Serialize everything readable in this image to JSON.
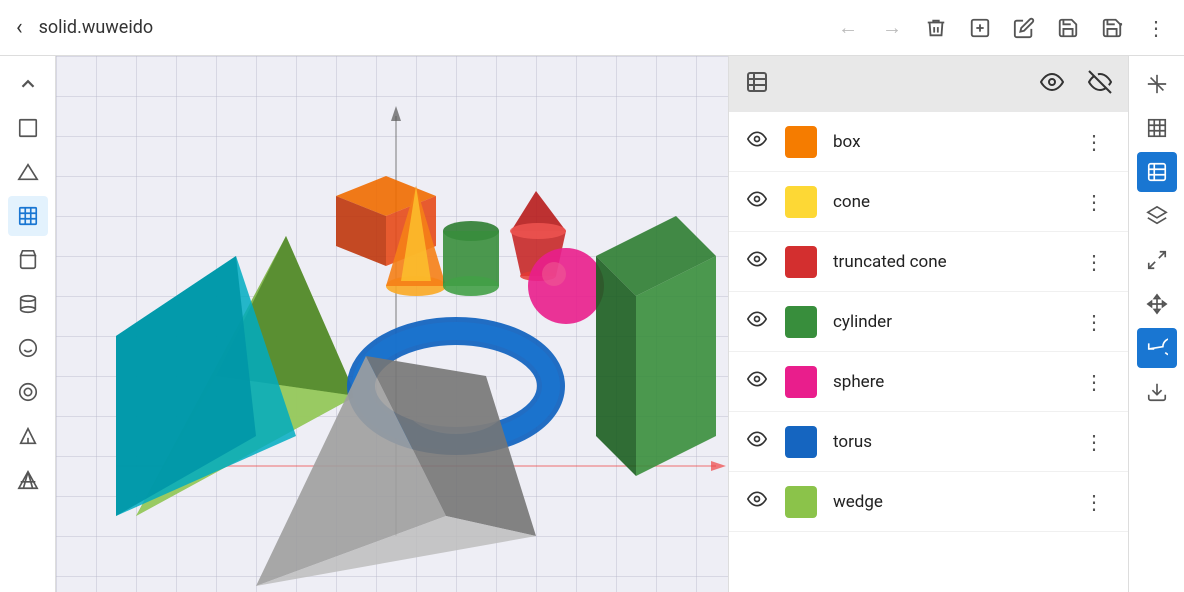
{
  "topbar": {
    "back_icon": "‹",
    "title": "solid.wuweido",
    "tools": [
      {
        "id": "back",
        "icon": "←",
        "label": "back",
        "disabled": true
      },
      {
        "id": "forward",
        "icon": "→",
        "label": "forward",
        "disabled": true
      },
      {
        "id": "delete",
        "icon": "🗑",
        "label": "delete"
      },
      {
        "id": "add",
        "icon": "⊞",
        "label": "add"
      },
      {
        "id": "edit",
        "icon": "✏",
        "label": "edit"
      },
      {
        "id": "save",
        "icon": "💾",
        "label": "save"
      },
      {
        "id": "save-as",
        "icon": "💾+",
        "label": "save-as"
      },
      {
        "id": "more",
        "icon": "⋮",
        "label": "more"
      }
    ]
  },
  "left_sidebar": {
    "icons": [
      {
        "id": "collapse",
        "icon": "∧",
        "label": "collapse"
      },
      {
        "id": "cube",
        "icon": "◻",
        "label": "cube"
      },
      {
        "id": "triangle",
        "icon": "△",
        "label": "triangle"
      },
      {
        "id": "active-cube",
        "icon": "▣",
        "label": "active-cube",
        "active": true
      },
      {
        "id": "bucket",
        "icon": "⊙",
        "label": "bucket"
      },
      {
        "id": "cylinder2d",
        "icon": "⊗",
        "label": "cylinder2d"
      },
      {
        "id": "face",
        "icon": "☺",
        "label": "face"
      },
      {
        "id": "ring",
        "icon": "◎",
        "label": "ring"
      },
      {
        "id": "triangle2",
        "icon": "◁",
        "label": "triangle2"
      },
      {
        "id": "prism",
        "icon": "◈",
        "label": "prism"
      }
    ]
  },
  "panel": {
    "header_icon": "≡",
    "items": [
      {
        "id": "box",
        "label": "box",
        "color": "#F57C00",
        "visible": true
      },
      {
        "id": "cone",
        "label": "cone",
        "color": "#FDD835",
        "visible": true
      },
      {
        "id": "truncated_cone",
        "label": "truncated cone",
        "color": "#D32F2F",
        "visible": true
      },
      {
        "id": "cylinder",
        "label": "cylinder",
        "color": "#388E3C",
        "visible": true
      },
      {
        "id": "sphere",
        "label": "sphere",
        "color": "#E91E8C",
        "visible": true
      },
      {
        "id": "torus",
        "label": "torus",
        "color": "#1565C0",
        "visible": true
      },
      {
        "id": "wedge",
        "label": "wedge",
        "color": "#8BC34A",
        "visible": true
      }
    ]
  },
  "right_sidebar": {
    "icons": [
      {
        "id": "axis",
        "icon": "⊹",
        "label": "axis"
      },
      {
        "id": "wireframe",
        "icon": "⊞",
        "label": "wireframe"
      },
      {
        "id": "layers-active",
        "icon": "≡",
        "label": "layers",
        "active": true
      },
      {
        "id": "layers2",
        "icon": "⊟",
        "label": "layers2"
      },
      {
        "id": "expand",
        "icon": "⤡",
        "label": "expand"
      },
      {
        "id": "move",
        "icon": "✛",
        "label": "move"
      },
      {
        "id": "undo-active",
        "icon": "↺",
        "label": "undo",
        "active": true
      },
      {
        "id": "download",
        "icon": "⬇",
        "label": "download"
      }
    ]
  },
  "colors": {
    "accent_blue": "#1976d2",
    "background": "#eeeef5",
    "panel_header": "#e8e8e8"
  }
}
